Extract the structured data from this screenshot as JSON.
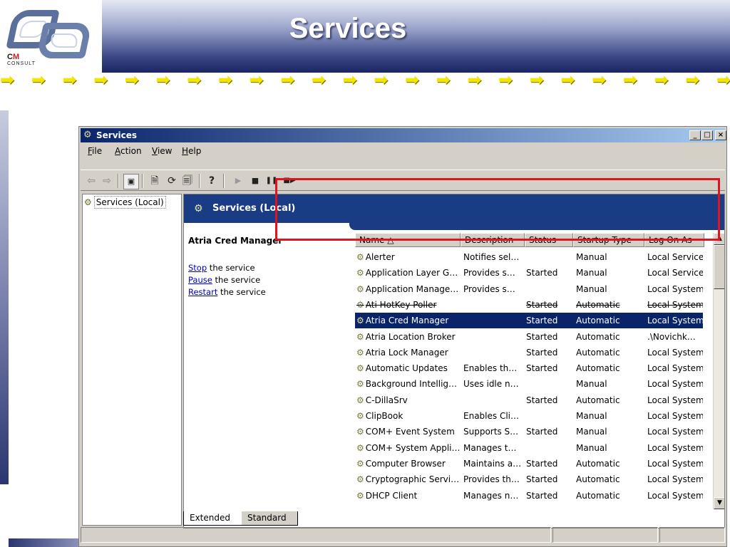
{
  "slide": {
    "title": "Services",
    "logo": {
      "cm_c": "C",
      "cm_m": "M",
      "consult": "CONSULT"
    },
    "arrow_glyph": "➡",
    "colors": {
      "arrows": "#f2e500",
      "header_dark": "#1c2563",
      "highlight": "#e0141e"
    }
  },
  "window": {
    "title": "Services",
    "controls": {
      "minimize": "_",
      "maximize": "□",
      "close": "×"
    }
  },
  "menu": [
    {
      "label": "File",
      "key": "F",
      "rest": "ile"
    },
    {
      "label": "Action",
      "key": "A",
      "rest": "ction"
    },
    {
      "label": "View",
      "key": "V",
      "rest": "iew"
    },
    {
      "label": "Help",
      "key": "H",
      "rest": "elp"
    }
  ],
  "toolbar": {
    "back": "⇦",
    "forward": "⇨",
    "show_hide_tree": "▣",
    "properties": "🗎",
    "refresh": "⟳",
    "export": "🗐",
    "help": "?",
    "start": "▶",
    "stop": "■",
    "pause": "❚❚",
    "restart": "■▶"
  },
  "tree": {
    "root": "Services (Local)",
    "icon": "services-gear-icon"
  },
  "pane": {
    "banner": "Services (Local)",
    "selected_service": "Atria Cred Manager",
    "actions": [
      {
        "link": "Stop",
        "text": " the service"
      },
      {
        "link": "Pause",
        "text": " the service"
      },
      {
        "link": "Restart",
        "text": " the service"
      }
    ]
  },
  "list": {
    "columns": {
      "name": "Name  △",
      "description": "Description",
      "status": "Status",
      "startup": "Startup Type",
      "logon": "Log On As"
    },
    "gear_glyph": "⚙",
    "rows": [
      {
        "name": "Alerter",
        "description": "Notifies sel…",
        "status": "",
        "startup": "Manual",
        "logon": "Local Service"
      },
      {
        "name": "Application Layer G…",
        "description": "Provides s…",
        "status": "Started",
        "startup": "Manual",
        "logon": "Local Service"
      },
      {
        "name": "Application Manage…",
        "description": "Provides s…",
        "status": "",
        "startup": "Manual",
        "logon": "Local System"
      },
      {
        "name": "Ati HotKey Poller",
        "description": "",
        "status": "Started",
        "startup": "Automatic",
        "logon": "Local System"
      },
      {
        "name": "Atria Cred Manager",
        "description": "",
        "status": "Started",
        "startup": "Automatic",
        "logon": "Local System"
      },
      {
        "name": "Atria Location Broker",
        "description": "",
        "status": "Started",
        "startup": "Automatic",
        "logon": ".\\Novichk…"
      },
      {
        "name": "Atria Lock Manager",
        "description": "",
        "status": "Started",
        "startup": "Automatic",
        "logon": "Local System"
      },
      {
        "name": "Automatic Updates",
        "description": "Enables th…",
        "status": "Started",
        "startup": "Automatic",
        "logon": "Local System"
      },
      {
        "name": "Background Intellig…",
        "description": "Uses idle n…",
        "status": "",
        "startup": "Manual",
        "logon": "Local System"
      },
      {
        "name": "C-DillaSrv",
        "description": "",
        "status": "Started",
        "startup": "Automatic",
        "logon": "Local System"
      },
      {
        "name": "ClipBook",
        "description": "Enables Cli…",
        "status": "",
        "startup": "Manual",
        "logon": "Local System"
      },
      {
        "name": "COM+ Event System",
        "description": "Supports S…",
        "status": "Started",
        "startup": "Manual",
        "logon": "Local System"
      },
      {
        "name": "COM+ System Appli…",
        "description": "Manages t…",
        "status": "",
        "startup": "Manual",
        "logon": "Local System"
      },
      {
        "name": "Computer Browser",
        "description": "Maintains a…",
        "status": "Started",
        "startup": "Automatic",
        "logon": "Local System"
      },
      {
        "name": "Cryptographic Servi…",
        "description": "Provides th…",
        "status": "Started",
        "startup": "Automatic",
        "logon": "Local System"
      },
      {
        "name": "DHCP Client",
        "description": "Manages n…",
        "status": "Started",
        "startup": "Automatic",
        "logon": "Local System"
      }
    ],
    "selected_index": 4,
    "struck_index": 3
  },
  "scrollbar": {
    "up": "▲",
    "down": "▼"
  },
  "tabs": [
    "Extended",
    "Standard"
  ]
}
